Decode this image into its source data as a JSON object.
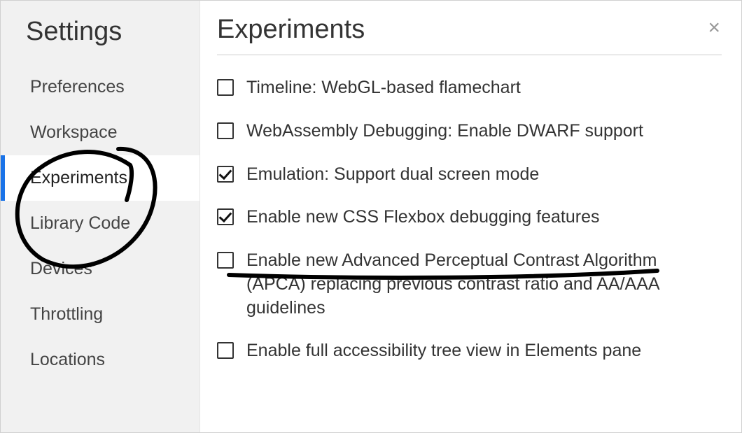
{
  "sidebar": {
    "title": "Settings",
    "items": [
      {
        "label": "Preferences",
        "active": false
      },
      {
        "label": "Workspace",
        "active": false
      },
      {
        "label": "Experiments",
        "active": true
      },
      {
        "label": "Library Code",
        "active": false
      },
      {
        "label": "Devices",
        "active": false
      },
      {
        "label": "Throttling",
        "active": false
      },
      {
        "label": "Locations",
        "active": false
      }
    ]
  },
  "main": {
    "title": "Experiments",
    "close_label": "×"
  },
  "experiments": [
    {
      "label": "Timeline: WebGL-based flamechart",
      "checked": false
    },
    {
      "label": "WebAssembly Debugging: Enable DWARF support",
      "checked": false
    },
    {
      "label": "Emulation: Support dual screen mode",
      "checked": true
    },
    {
      "label": "Enable new CSS Flexbox debugging features",
      "checked": true
    },
    {
      "label": "Enable new Advanced Perceptual Contrast Algorithm (APCA) replacing previous contrast ratio and AA/AAA guidelines",
      "checked": false
    },
    {
      "label": "Enable full accessibility tree view in Elements pane",
      "checked": false
    }
  ],
  "annotations": {
    "circle_target": "Experiments",
    "underline_target": "Enable new CSS Flexbox debugging features"
  }
}
